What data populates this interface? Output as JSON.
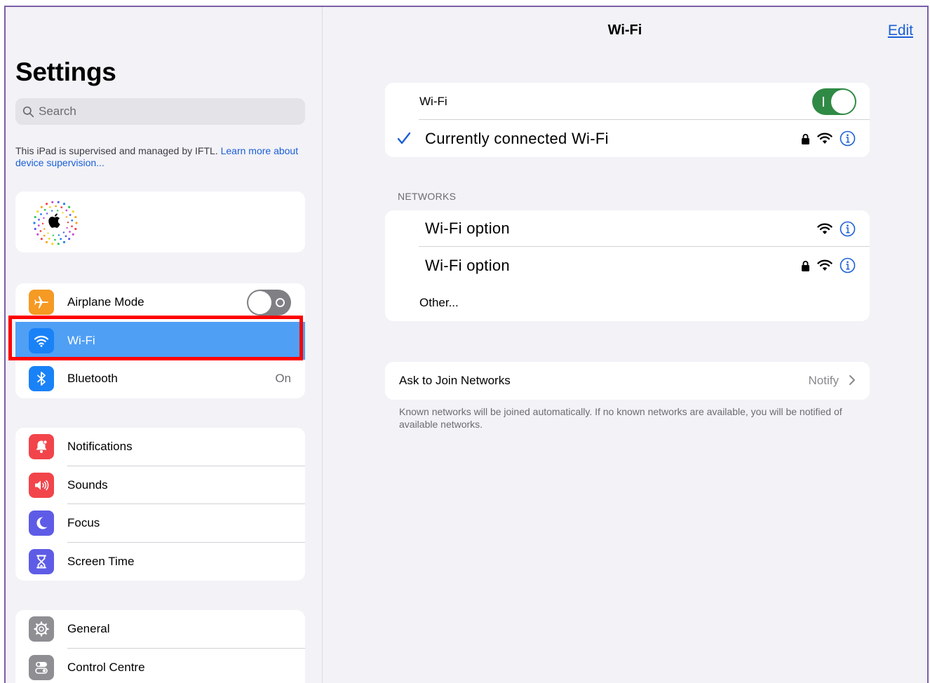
{
  "sidebar": {
    "title": "Settings",
    "search_placeholder": "Search",
    "supervision_text": "This iPad is supervised and managed by IFTL.",
    "supervision_link": "Learn more about device supervision...",
    "group1": [
      {
        "label": "Airplane Mode",
        "icon": "airplane-icon",
        "color": "#f59a23",
        "toggle": "off"
      },
      {
        "label": "Wi-Fi",
        "icon": "wifi-icon",
        "color": "#1a82f7",
        "selected": true
      },
      {
        "label": "Bluetooth",
        "icon": "bluetooth-icon",
        "color": "#1a82f7",
        "value": "On"
      }
    ],
    "group2": [
      {
        "label": "Notifications",
        "icon": "bell-icon",
        "color": "#f2444b"
      },
      {
        "label": "Sounds",
        "icon": "speaker-icon",
        "color": "#f2444b"
      },
      {
        "label": "Focus",
        "icon": "moon-icon",
        "color": "#5e5ce6"
      },
      {
        "label": "Screen Time",
        "icon": "hourglass-icon",
        "color": "#5e5ce6"
      }
    ],
    "group3": [
      {
        "label": "General",
        "icon": "gear-icon",
        "color": "#8e8e93"
      },
      {
        "label": "Control Centre",
        "icon": "toggles-icon",
        "color": "#8e8e93"
      }
    ]
  },
  "detail": {
    "title": "Wi-Fi",
    "edit_label": "Edit",
    "wifi_label": "Wi-Fi",
    "wifi_toggle": "on",
    "connected_network": "Currently connected Wi-Fi",
    "networks_header": "NETWORKS",
    "networks": [
      {
        "name": "Wi-Fi option",
        "locked": false
      },
      {
        "name": "Wi-Fi option",
        "locked": true
      }
    ],
    "other_label": "Other...",
    "ask_label": "Ask to Join Networks",
    "ask_value": "Notify",
    "footnote": "Known networks will be joined automatically. If no known networks are available, you will be notified of available networks."
  },
  "colors": {
    "accent": "#1a5fd6",
    "selected_row": "#4f9ff5",
    "toggle_on": "#2f8a45",
    "highlight": "#ff0000"
  }
}
